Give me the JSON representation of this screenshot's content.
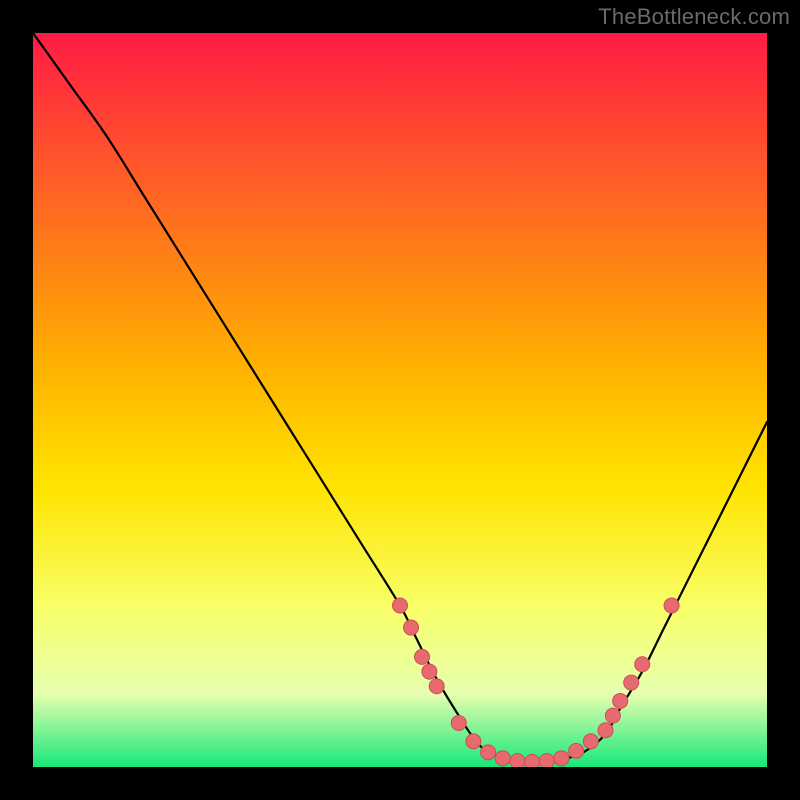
{
  "watermark": "TheBottleneck.com",
  "colors": {
    "frame": "#000000",
    "grad_top": "#ff1b45",
    "grad_mid1": "#ffb000",
    "grad_mid2": "#ffe400",
    "grad_low": "#f8ff66",
    "grad_pale": "#e6ffb0",
    "grad_bottom": "#17e879",
    "curve": "#000000",
    "marker_fill": "#e66a6f",
    "marker_stroke": "#cc4e54"
  },
  "chart_data": {
    "type": "line",
    "title": "",
    "xlabel": "",
    "ylabel": "",
    "xlim": [
      0,
      100
    ],
    "ylim": [
      0,
      100
    ],
    "series": [
      {
        "name": "bottleneck-curve",
        "x": [
          0,
          5,
          10,
          15,
          20,
          25,
          30,
          35,
          40,
          45,
          50,
          52,
          55,
          58,
          60,
          62,
          65,
          68,
          70,
          72,
          75,
          78,
          80,
          83,
          86,
          90,
          94,
          98,
          100
        ],
        "y": [
          100,
          93,
          86,
          78,
          70,
          62,
          54,
          46,
          38,
          30,
          22,
          18,
          12,
          7,
          4,
          2,
          1,
          0.5,
          0.5,
          1,
          2,
          4.5,
          8,
          13,
          19,
          27,
          35,
          43,
          47
        ]
      }
    ],
    "markers": {
      "name": "highlighted-points",
      "points": [
        {
          "x": 50,
          "y": 22
        },
        {
          "x": 51.5,
          "y": 19
        },
        {
          "x": 53,
          "y": 15
        },
        {
          "x": 54,
          "y": 13
        },
        {
          "x": 55,
          "y": 11
        },
        {
          "x": 58,
          "y": 6
        },
        {
          "x": 60,
          "y": 3.5
        },
        {
          "x": 62,
          "y": 2
        },
        {
          "x": 64,
          "y": 1.2
        },
        {
          "x": 66,
          "y": 0.8
        },
        {
          "x": 68,
          "y": 0.7
        },
        {
          "x": 70,
          "y": 0.8
        },
        {
          "x": 72,
          "y": 1.2
        },
        {
          "x": 74,
          "y": 2.2
        },
        {
          "x": 76,
          "y": 3.5
        },
        {
          "x": 78,
          "y": 5
        },
        {
          "x": 79,
          "y": 7
        },
        {
          "x": 80,
          "y": 9
        },
        {
          "x": 81.5,
          "y": 11.5
        },
        {
          "x": 83,
          "y": 14
        },
        {
          "x": 87,
          "y": 22
        }
      ]
    }
  }
}
